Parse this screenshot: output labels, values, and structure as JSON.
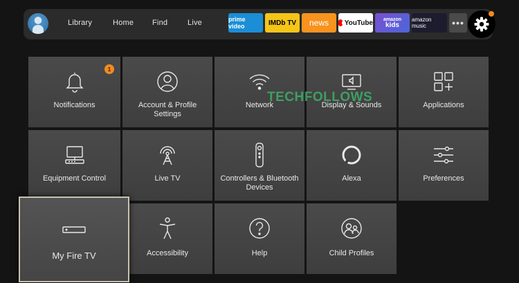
{
  "nav": {
    "links": [
      "Library",
      "Home",
      "Find",
      "Live"
    ],
    "apps": {
      "prime": "prime video",
      "imdb": "IMDb TV",
      "news": "news",
      "youtube": "YouTube",
      "kids_top": "amazon",
      "kids_bottom": "kids",
      "music": "amazon music",
      "more": "•••"
    },
    "settings_icon": "gear-icon"
  },
  "tiles": [
    {
      "label": "Notifications",
      "icon": "bell-icon",
      "badge": "1"
    },
    {
      "label": "Account & Profile Settings",
      "icon": "person-icon"
    },
    {
      "label": "Network",
      "icon": "wifi-icon"
    },
    {
      "label": "Display & Sounds",
      "icon": "display-icon"
    },
    {
      "label": "Applications",
      "icon": "apps-grid-icon"
    },
    {
      "label": "Equipment Control",
      "icon": "computer-icon"
    },
    {
      "label": "Live TV",
      "icon": "antenna-icon"
    },
    {
      "label": "Controllers & Bluetooth Devices",
      "icon": "remote-icon"
    },
    {
      "label": "Alexa",
      "icon": "alexa-ring-icon"
    },
    {
      "label": "Preferences",
      "icon": "sliders-icon"
    },
    {
      "label": "My Fire TV",
      "icon": "fire-tv-device-icon",
      "focused": true
    },
    {
      "label": "Accessibility",
      "icon": "accessibility-icon"
    },
    {
      "label": "Help",
      "icon": "help-icon"
    },
    {
      "label": "Child Profiles",
      "icon": "child-profiles-icon"
    }
  ],
  "watermark": "TECHFOLLOWS",
  "colors": {
    "accent": "#f28b1e",
    "tile": "#454545",
    "background": "#141414",
    "focus_border": "#c9c2b0"
  }
}
